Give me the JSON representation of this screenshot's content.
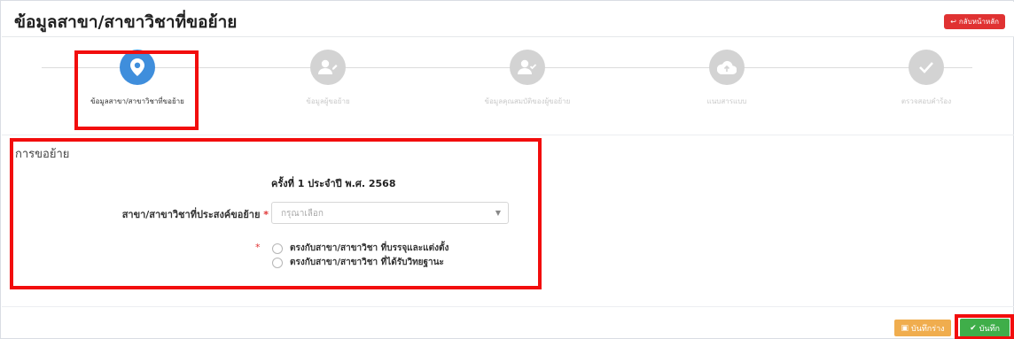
{
  "header": {
    "title": "ข้อมูลสาขา/สาขาวิชาที่ขอย้าย",
    "back_label": "กลับหน้าหลัก",
    "back_icon": "arrow-return-icon"
  },
  "steps": [
    {
      "label": "ข้อมูลสาขา/สาขาวิชาที่ขอย้าย",
      "icon": "map-marker-icon",
      "active": true
    },
    {
      "label": "ข้อมูลผู้ขอย้าย",
      "icon": "user-edit-icon",
      "active": false
    },
    {
      "label": "ข้อมูลคุณสมบัติของผู้ขอย้าย",
      "icon": "user-check-icon",
      "active": false
    },
    {
      "label": "แนบสารแบบ",
      "icon": "cloud-upload-icon",
      "active": false
    },
    {
      "label": "ตรวจสอบคำร้อง",
      "icon": "check-icon",
      "active": false
    }
  ],
  "form": {
    "section_title": "การขอย้าย",
    "round_text": "ครั้งที่ 1 ประจำปี พ.ศ. 2568",
    "field_label": "สาขา/สาขาวิชาที่ประสงค์ขอย้าย",
    "required_mark": "*",
    "select_placeholder": "กรุณาเลือก",
    "radio_options": [
      "ตรงกับสาขา/สาขาวิชา ที่บรรจุและแต่งตั้ง",
      "ตรงกับสาขา/สาขาวิชา ที่ได้รับวิทยฐานะ"
    ]
  },
  "footer": {
    "draft_label": "บันทึกร่าง",
    "save_label": "บันทึก"
  },
  "colors": {
    "accent": "#3f8edc",
    "highlight_box": "#f20d0d",
    "back_button": "#e03232",
    "draft_button": "#f0ad4e",
    "save_button": "#3fae49"
  }
}
